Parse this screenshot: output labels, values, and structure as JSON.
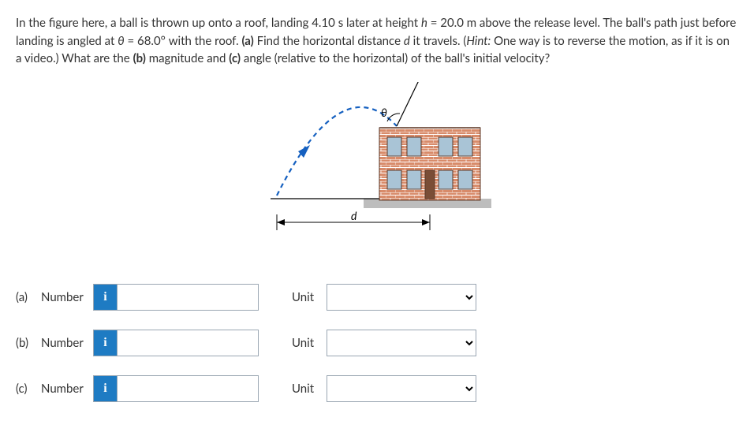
{
  "problem": {
    "text_html": "In the figure here, a ball is thrown up onto a roof, landing 4.10 s later at height <i>h</i> = 20.0 m above the release level. The ball's path just before landing is angled at <i>θ</i> = 68.0° with the roof. <b>(a)</b> Find the horizontal distance <i>d</i> it travels. (<i>Hint:</i> One way is to reverse the motion, as if it is on a video.) What are the <b>(b)</b> magnitude and <b>(c)</b> angle (relative to the horizontal) of the ball's initial velocity?"
  },
  "figure": {
    "theta_label": "θ",
    "d_label": "d"
  },
  "answers": [
    {
      "part": "(a)",
      "number_label": "Number",
      "info_glyph": "i",
      "unit_label": "Unit",
      "value": "",
      "unit": ""
    },
    {
      "part": "(b)",
      "number_label": "Number",
      "info_glyph": "i",
      "unit_label": "Unit",
      "value": "",
      "unit": ""
    },
    {
      "part": "(c)",
      "number_label": "Number",
      "info_glyph": "i",
      "unit_label": "Unit",
      "value": "",
      "unit": ""
    }
  ]
}
